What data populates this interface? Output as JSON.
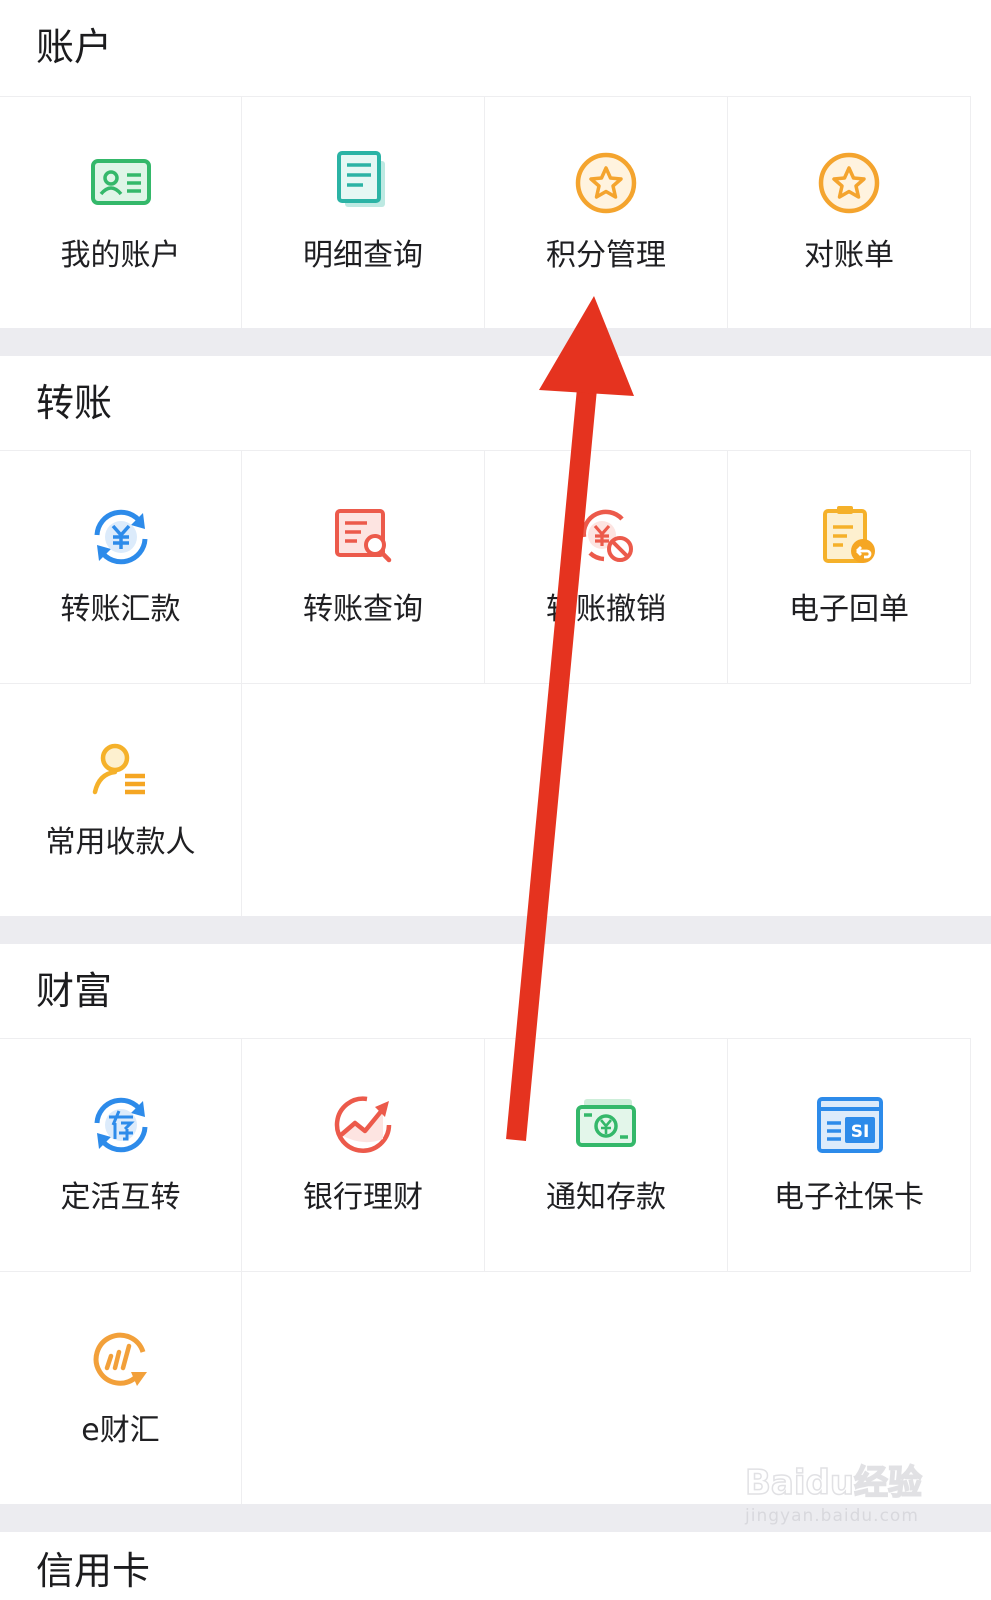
{
  "sections": [
    {
      "title": "账户",
      "items": [
        {
          "label": "我的账户",
          "icon": "id-card-icon"
        },
        {
          "label": "明细查询",
          "icon": "document-list-icon"
        },
        {
          "label": "积分管理",
          "icon": "star-badge-icon"
        },
        {
          "label": "对账单",
          "icon": "star-badge-icon"
        }
      ]
    },
    {
      "title": "转账",
      "items": [
        {
          "label": "转账汇款",
          "icon": "yuan-exchange-icon"
        },
        {
          "label": "转账查询",
          "icon": "document-search-icon"
        },
        {
          "label": "转账撤销",
          "icon": "yuan-cancel-icon"
        },
        {
          "label": "电子回单",
          "icon": "receipt-return-icon"
        },
        {
          "label": "常用收款人",
          "icon": "payee-contact-icon"
        }
      ]
    },
    {
      "title": "财富",
      "items": [
        {
          "label": "定活互转",
          "icon": "deposit-exchange-icon"
        },
        {
          "label": "银行理财",
          "icon": "trend-up-icon"
        },
        {
          "label": "通知存款",
          "icon": "banknote-icon"
        },
        {
          "label": "电子社保卡",
          "icon": "si-card-icon"
        },
        {
          "label": "e财汇",
          "icon": "e-wealth-icon"
        }
      ]
    },
    {
      "title": "信用卡"
    }
  ],
  "colors": {
    "green": "#34b86a",
    "teal": "#2bb3a5",
    "orange": "#f4a42e",
    "blue": "#2d8bea",
    "red": "#ec5a4b",
    "yellow": "#f5b12a",
    "arrow": "#e5331f"
  },
  "watermark": {
    "brand": "Baidu经验",
    "url": "jingyan.baidu.com"
  }
}
